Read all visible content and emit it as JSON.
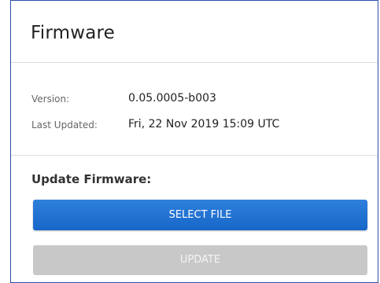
{
  "panel": {
    "title": "Firmware"
  },
  "info": {
    "version_label": "Version:",
    "version_value": "0.05.0005-b003",
    "updated_label": "Last Updated:",
    "updated_value": "Fri, 22 Nov 2019 15:09 UTC"
  },
  "update": {
    "section_title": "Update Firmware:",
    "select_file_label": "SELECT FILE",
    "update_label": "UPDATE"
  },
  "colors": {
    "primary_button": "#1f72d3",
    "disabled_button": "#c8c8c8",
    "frame_border": "#2f4fa8"
  }
}
